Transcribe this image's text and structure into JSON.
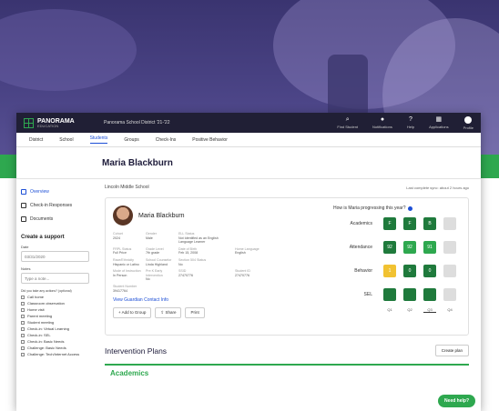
{
  "app": {
    "logo_text": "PANORAMA",
    "logo_sub": "EDUCATION",
    "district": "Panorama School District '21-'22",
    "nav": [
      {
        "label": "Find Student",
        "icon": "search-icon"
      },
      {
        "label": "Notifications",
        "icon": "bell-icon"
      },
      {
        "label": "Help",
        "icon": "help-icon"
      },
      {
        "label": "Applications",
        "icon": "grid-icon"
      },
      {
        "label": "Profile",
        "icon": "user-icon"
      }
    ]
  },
  "tabs": [
    "District",
    "School",
    "Students",
    "Groups",
    "Check-Ins",
    "Positive Behavior"
  ],
  "active_tab": "Students",
  "student": {
    "name": "Maria Blackburn"
  },
  "sidebar": {
    "items": [
      "Overview",
      "Check-in Responses",
      "Documents"
    ],
    "create_support": "Create a support",
    "date_label": "Date",
    "date_value": "03/31/2020",
    "notes_label": "Notes",
    "notes_placeholder": "Type a note...",
    "question": "Did you take any actions? (optional)",
    "actions": [
      "Call home",
      "Classroom observation",
      "Home visit",
      "Parent meeting",
      "Student meeting",
      "Check-in: Virtual Learning",
      "Check-in: SEL",
      "Check-in: Basic Needs",
      "Challenge: Basic Needs",
      "Challenge: Tech/Internet Access"
    ]
  },
  "main": {
    "school": "Lincoln Middle School",
    "sync": "Last complete sync: about 2 hours ago",
    "profile_name": "Maria Blackburn",
    "fields": [
      {
        "k": "Cohort",
        "v": "2024"
      },
      {
        "k": "Gender",
        "v": "Male"
      },
      {
        "k": "ELL Status",
        "v": "Not Identified as an English Language Learner"
      },
      {
        "k": "",
        "v": ""
      },
      {
        "k": "",
        "v": ""
      },
      {
        "k": "FRPL Status",
        "v": "Full Price"
      },
      {
        "k": "Grade Level",
        "v": "7th grade"
      },
      {
        "k": "Date of Birth",
        "v": "Feb 15, 2008"
      },
      {
        "k": "Home Language",
        "v": "English"
      },
      {
        "k": "",
        "v": ""
      },
      {
        "k": "Race/Ethnicity",
        "v": "Hispanic or Latino"
      },
      {
        "k": "School Counselor",
        "v": "Linda Highland"
      },
      {
        "k": "Section 504 Status",
        "v": "No"
      },
      {
        "k": "",
        "v": ""
      },
      {
        "k": "",
        "v": ""
      },
      {
        "k": "Mode of Instruction",
        "v": "In Person"
      },
      {
        "k": "Pre K Early Intervention",
        "v": "No"
      },
      {
        "k": "SSID",
        "v": "27470776"
      },
      {
        "k": "Student ID",
        "v": "27470776"
      },
      {
        "k": "",
        "v": ""
      },
      {
        "k": "Student Number",
        "v": "39417764"
      }
    ],
    "guardian_link": "View Guardian Contact Info",
    "buttons": [
      "Add to Group",
      "Share",
      "Print"
    ],
    "progress_q": "How is Maria progressing this year?",
    "progress": [
      {
        "label": "Academics",
        "boxes": [
          [
            "g",
            "F"
          ],
          [
            "g",
            "F"
          ],
          [
            "g",
            "B"
          ],
          [
            "gy",
            ""
          ]
        ]
      },
      {
        "label": "Attendance",
        "boxes": [
          [
            "g",
            "92"
          ],
          [
            "lg",
            "92"
          ],
          [
            "lg",
            "91"
          ],
          [
            "gy",
            ""
          ]
        ]
      },
      {
        "label": "Behavior",
        "boxes": [
          [
            "y",
            "1"
          ],
          [
            "g",
            "0"
          ],
          [
            "g",
            "0"
          ],
          [
            "gy",
            ""
          ]
        ]
      },
      {
        "label": "SEL",
        "boxes": [
          [
            "g",
            ""
          ],
          [
            "g",
            ""
          ],
          [
            "g",
            ""
          ],
          [
            "gy",
            ""
          ]
        ]
      }
    ],
    "terms": [
      "Q1",
      "Q2",
      "Q3",
      "Q4"
    ],
    "selected_term": "Q3",
    "interventions_title": "Intervention Plans",
    "create_plan": "Create plan",
    "academics": "Academics",
    "need_help": "Need help?"
  },
  "colors": {
    "brand_dark": "#201f35",
    "accent_green": "#2ea84f",
    "link_blue": "#1d4fd6"
  }
}
